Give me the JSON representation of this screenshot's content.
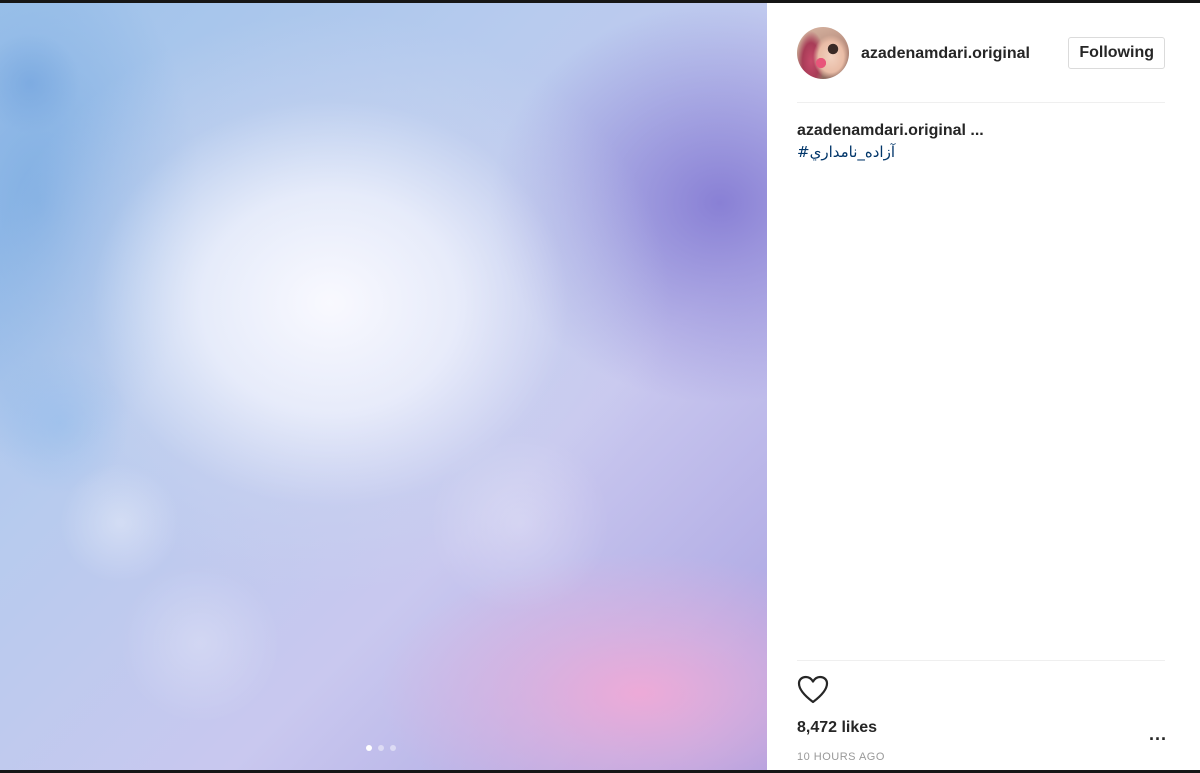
{
  "post": {
    "carousel": {
      "total_images": 3,
      "active_index": 0
    },
    "author": {
      "username": "azadenamdari.original",
      "follow_label": "Following"
    },
    "caption": {
      "username": "azadenamdari.original",
      "ellipsis": "...",
      "hashtag": "#آزاده_نامداري"
    },
    "likes_label": "8,472 likes",
    "more_label": "...",
    "timestamp": "10 HOURS AGO",
    "icons": {
      "like": "heart-icon",
      "more": "more-options-icon"
    }
  }
}
